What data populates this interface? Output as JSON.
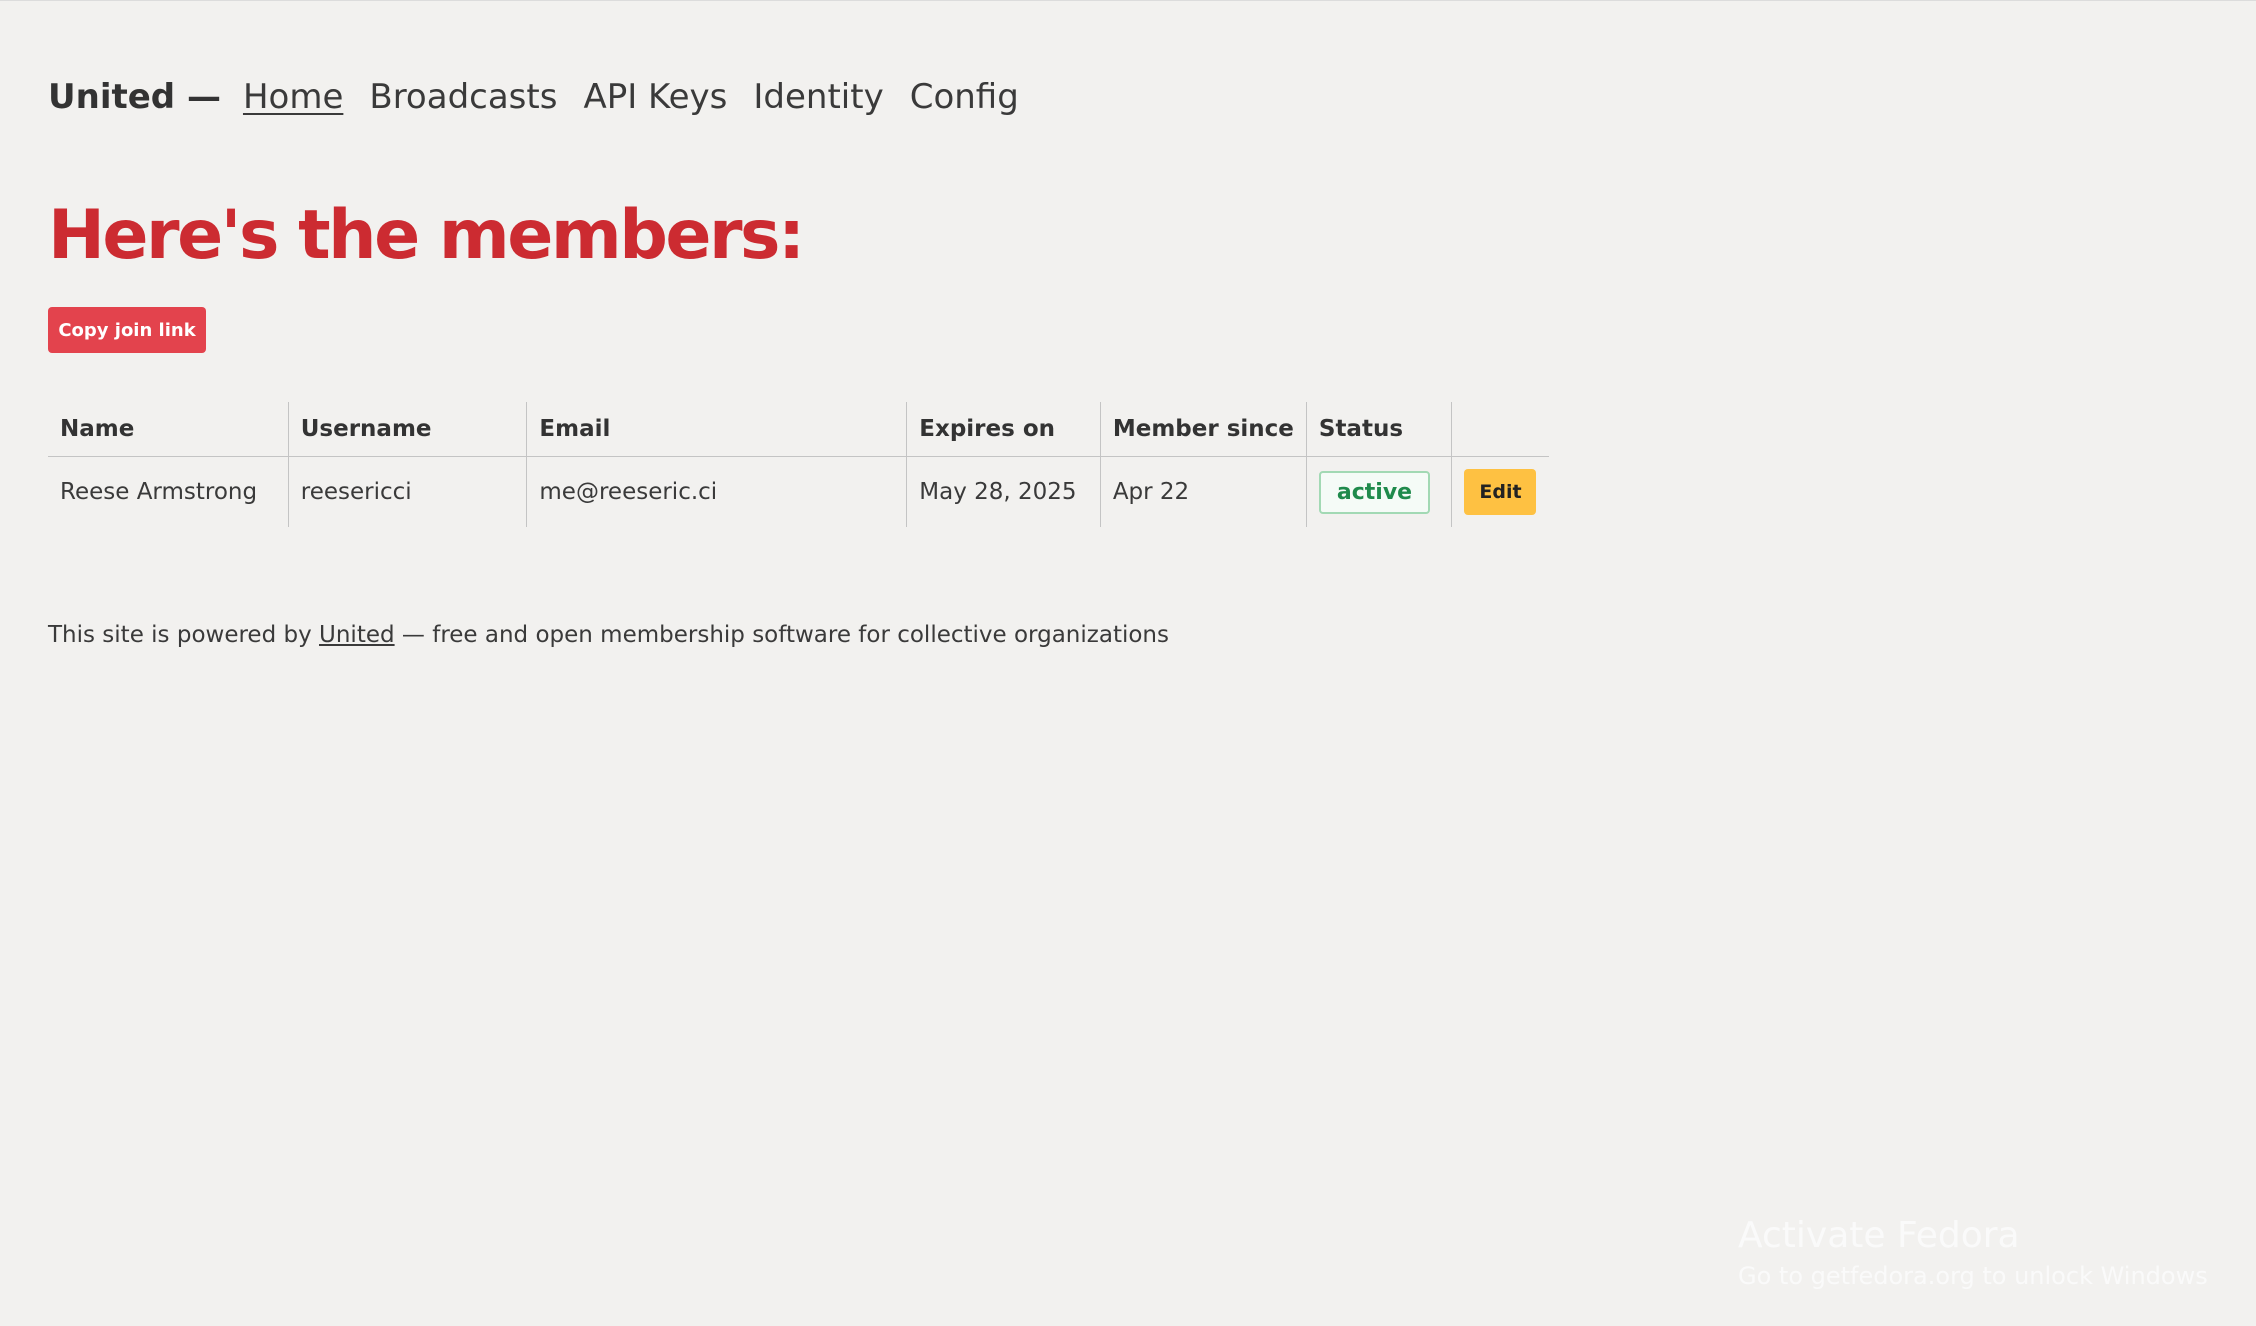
{
  "nav": {
    "brand": "United —",
    "links": [
      {
        "label": "Home",
        "active": true
      },
      {
        "label": "Broadcasts"
      },
      {
        "label": "API Keys"
      },
      {
        "label": "Identity"
      },
      {
        "label": "Config"
      }
    ]
  },
  "page": {
    "title": "Here's the members:",
    "copy_button": "Copy join link"
  },
  "table": {
    "headers": [
      "Name",
      "Username",
      "Email",
      "Expires on",
      "Member since",
      "Status",
      ""
    ],
    "rows": [
      {
        "name": "Reese Armstrong",
        "username": "reesericci",
        "email": "me@reeseric.ci",
        "expires_on": "May 28, 2025",
        "member_since": "Apr 22",
        "status": "active",
        "action": "Edit"
      }
    ]
  },
  "footer": {
    "prefix": "This site is powered by ",
    "link": "United",
    "suffix": " — free and open membership software for collective organizations"
  },
  "watermark": {
    "title": "Activate Fedora",
    "subtitle": "Go to getfedora.org to unlock Windows"
  },
  "colors": {
    "background": "#f2f1ef",
    "title": "#cc2b31",
    "copy_button": "#e3434d",
    "edit_button": "#fec142",
    "status_active": "#1f8a4c"
  }
}
